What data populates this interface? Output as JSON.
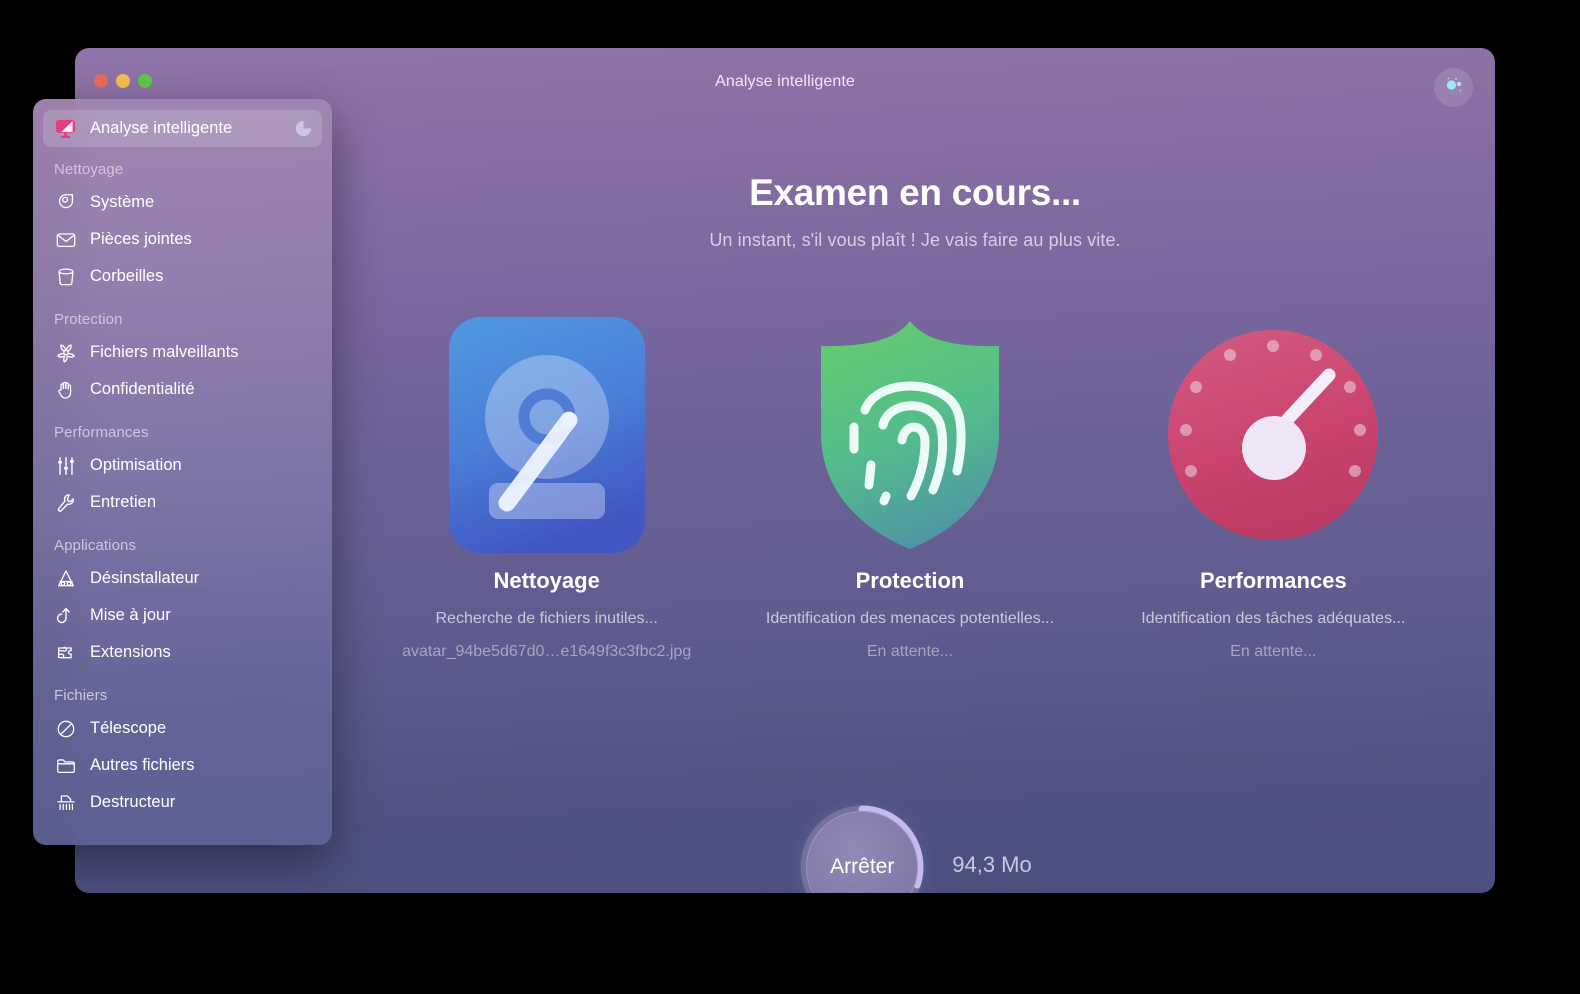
{
  "window": {
    "title": "Analyse intelligente",
    "traffic_lights": [
      {
        "name": "close",
        "color": "#ec6a5f"
      },
      {
        "name": "minimize",
        "color": "#f3bf4f"
      },
      {
        "name": "maximize",
        "color": "#61c554"
      }
    ],
    "account_button_icon": "account-orb-icon"
  },
  "sidebar": {
    "active_item": {
      "label": "Analyse intelligente",
      "icon": "smart-scan-monitor-icon",
      "progress_icon": "pie-progress-icon"
    },
    "sections": [
      {
        "title": "Nettoyage",
        "items": [
          {
            "label": "Système",
            "icon": "system-junk-icon"
          },
          {
            "label": "Pièces jointes",
            "icon": "mail-attachment-icon"
          },
          {
            "label": "Corbeilles",
            "icon": "trash-bins-icon"
          }
        ]
      },
      {
        "title": "Protection",
        "items": [
          {
            "label": "Fichiers malveillants",
            "icon": "biohazard-malware-icon"
          },
          {
            "label": "Confidentialité",
            "icon": "privacy-hand-icon"
          }
        ]
      },
      {
        "title": "Performances",
        "items": [
          {
            "label": "Optimisation",
            "icon": "sliders-optimization-icon"
          },
          {
            "label": "Entretien",
            "icon": "wrench-maintenance-icon"
          }
        ]
      },
      {
        "title": "Applications",
        "items": [
          {
            "label": "Désinstallateur",
            "icon": "uninstaller-icon"
          },
          {
            "label": "Mise à jour",
            "icon": "updater-arrow-icon"
          },
          {
            "label": "Extensions",
            "icon": "puzzle-extensions-icon"
          }
        ]
      },
      {
        "title": "Fichiers",
        "items": [
          {
            "label": "Télescope",
            "icon": "telescope-space-lens-icon"
          },
          {
            "label": "Autres fichiers",
            "icon": "folder-icon"
          },
          {
            "label": "Destructeur",
            "icon": "shredder-icon"
          }
        ]
      }
    ]
  },
  "main": {
    "heading": "Examen en cours...",
    "subheading": "Un instant, s'il vous plaît ! Je vais faire au plus vite.",
    "cards": [
      {
        "title": "Nettoyage",
        "status": "Recherche de fichiers inutiles...",
        "detail": "avatar_94be5d67d0…e1649f3c3fbc2.jpg",
        "icon": "hard-disk-icon",
        "accent": "#4f7fd6"
      },
      {
        "title": "Protection",
        "status": "Identification des menaces potentielles...",
        "detail": "En attente...",
        "icon": "shield-fingerprint-icon",
        "accent": "#5ec47e"
      },
      {
        "title": "Performances",
        "status": "Identification des tâches adéquates...",
        "detail": "En attente...",
        "icon": "speedometer-icon",
        "accent": "#cf4b76"
      }
    ],
    "stop_button": {
      "label": "Arrêter",
      "progress_percent": 30
    },
    "scanned_size": "94,3 Mo"
  },
  "colors": {
    "bg_top": "#8f74a9",
    "bg_bottom": "#4b5080",
    "accent_ring": "#c9bcf2"
  }
}
